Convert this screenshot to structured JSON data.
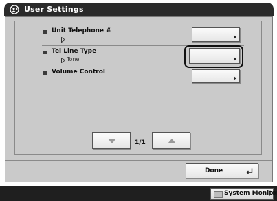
{
  "window": {
    "title": "User Settings",
    "title_icon": "user-settings-icon"
  },
  "settings": [
    {
      "label": "Unit Telephone #",
      "value": ""
    },
    {
      "label": "Tel Line Type",
      "value": "Tone"
    },
    {
      "label": "Volume Control",
      "value": ""
    }
  ],
  "pagination": {
    "page": "1/1"
  },
  "footer": {
    "done_label": "Done"
  },
  "statusbar": {
    "system_monitor_label": "System Monitor"
  }
}
